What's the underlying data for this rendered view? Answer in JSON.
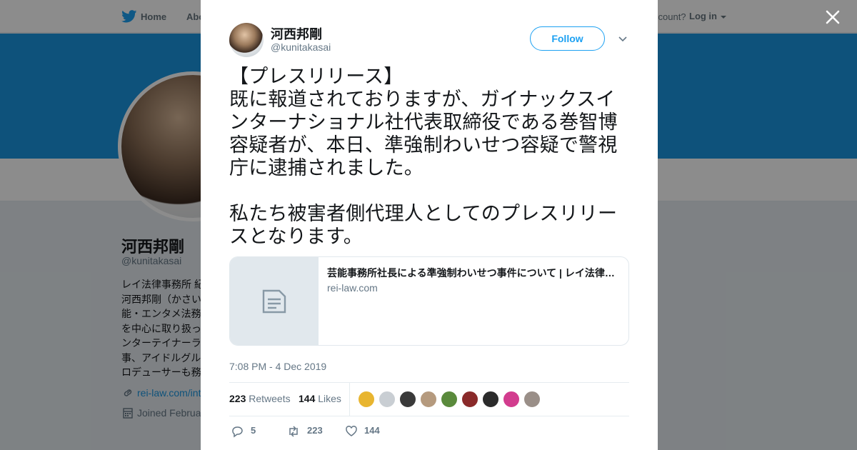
{
  "nav": {
    "home": "Home",
    "about": "Abo",
    "account_prompt": "ccount?",
    "login": "Log in"
  },
  "profile": {
    "name": "河西邦剛",
    "handle": "@kunitakasai",
    "bio_lines": [
      "レイ法律事務所 紀",
      "河西邦剛（かさい",
      "能・エンタメ法務",
      "を中心に取り扱っ",
      "ンターテイナーラ",
      "事、アイドルグル",
      "ロデューサーも務"
    ],
    "link": "rei-law.com/int",
    "joined": "Joined Februa"
  },
  "tweet": {
    "author_name": "河西邦剛",
    "author_handle": "@kunitakasai",
    "follow_label": "Follow",
    "text": "【プレスリリース】\n既に報道されておりますが、ガイナックスインターナショナル社代表取締役である巻智博容疑者が、本日、準強制わいせつ容疑で警視庁に逮捕されました。\n\n私たち被害者側代理人としてのプレスリリースとなります。",
    "card": {
      "title": "芸能事務所社長による準強制わいせつ事件について | レイ法律事務所",
      "domain": "rei-law.com"
    },
    "timestamp": "7:08 PM - 4 Dec 2019",
    "retweets_count": "223",
    "retweets_label": "Retweets",
    "likes_count": "144",
    "likes_label": "Likes",
    "liker_colors": [
      "#e8b530",
      "#c9ced3",
      "#3a3a3a",
      "#b59a7e",
      "#5a8a3c",
      "#8a2a2a",
      "#2b2b2b",
      "#d23c8e",
      "#9a8f88"
    ],
    "actions": {
      "replies": "5",
      "retweets": "223",
      "likes": "144"
    }
  },
  "colors": {
    "brand_blue": "#1da1f2",
    "banner_blue": "#1b95e0",
    "muted_text": "#657786"
  }
}
